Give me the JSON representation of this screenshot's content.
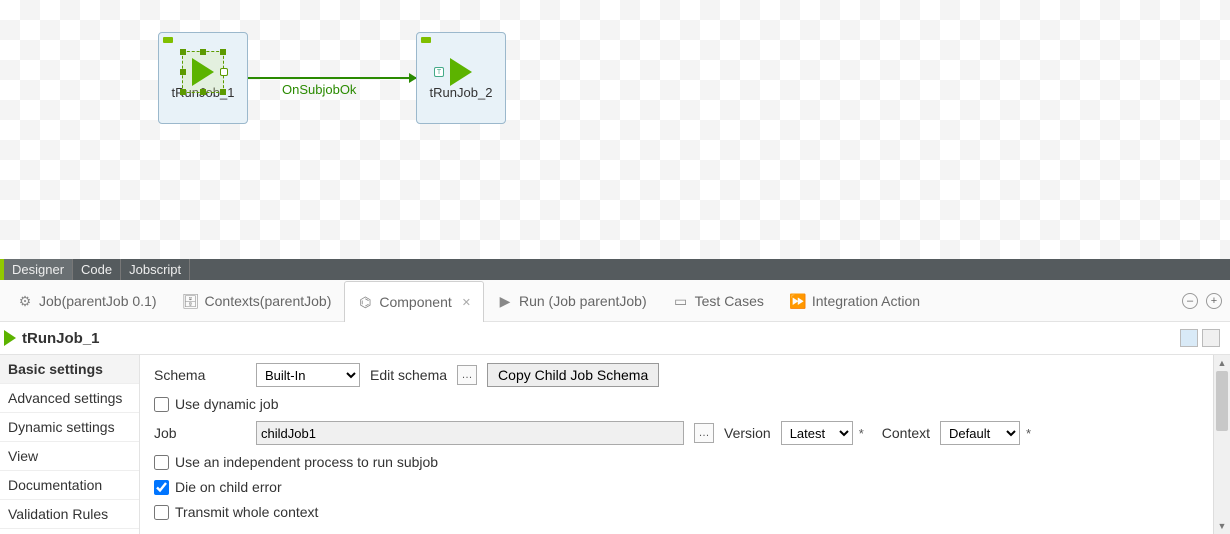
{
  "canvas": {
    "comp1": {
      "label": "tRunJob_1"
    },
    "comp2": {
      "label": "tRunJob_2"
    },
    "edge": {
      "label": "OnSubjobOk"
    }
  },
  "editorTabs": {
    "t0": "Designer",
    "t1": "Code",
    "t2": "Jobscript"
  },
  "views": {
    "job": "Job(parentJob 0.1)",
    "ctx": "Contexts(parentJob)",
    "comp": "Component",
    "run": "Run (Job parentJob)",
    "tests": "Test Cases",
    "integ": "Integration Action"
  },
  "header": {
    "title": "tRunJob_1"
  },
  "side": {
    "basic": "Basic settings",
    "adv": "Advanced settings",
    "dyn": "Dynamic settings",
    "view": "View",
    "doc": "Documentation",
    "val": "Validation Rules"
  },
  "form": {
    "schema_label": "Schema",
    "schema_value": "Built-In",
    "edit_schema": "Edit schema",
    "copy_child": "Copy Child Job Schema",
    "use_dynamic": "Use dynamic job",
    "job_label": "Job",
    "job_value": "childJob1",
    "version_label": "Version",
    "version_value": "Latest",
    "context_label": "Context",
    "context_value": "Default",
    "independent": "Use an independent process to run subjob",
    "die_on_child": "Die on child error",
    "transmit_ctx": "Transmit whole context"
  }
}
